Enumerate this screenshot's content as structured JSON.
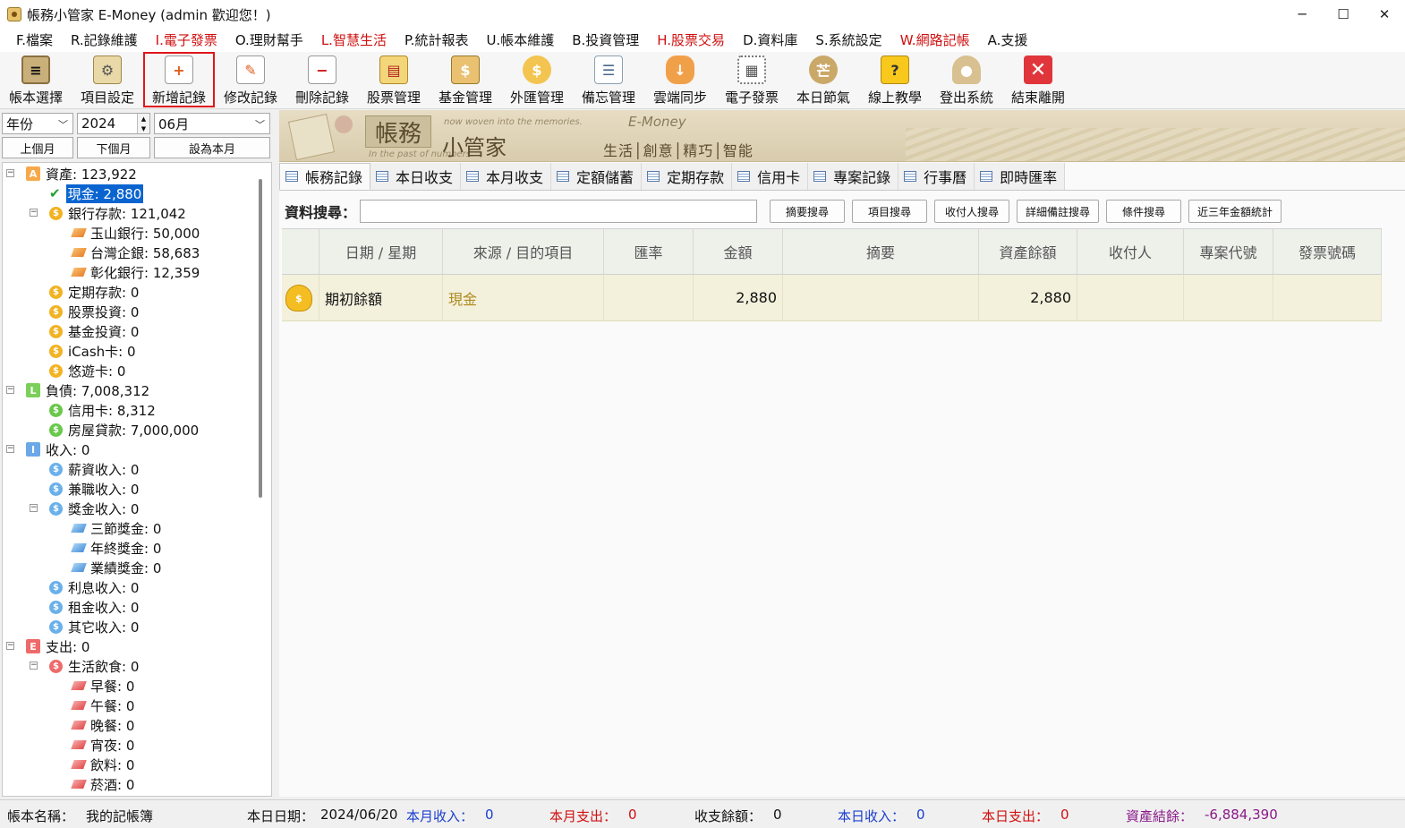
{
  "window": {
    "title": "帳務小管家 E-Money (admin 歡迎您！)",
    "minimize": "─",
    "maximize": "☐",
    "close": "✕"
  },
  "menu": [
    {
      "label": "F.檔案",
      "red": false
    },
    {
      "label": "R.記錄維護",
      "red": false
    },
    {
      "label": "I.電子發票",
      "red": true
    },
    {
      "label": "O.理財幫手",
      "red": false
    },
    {
      "label": "L.智慧生活",
      "red": true
    },
    {
      "label": "P.統計報表",
      "red": false
    },
    {
      "label": "U.帳本維護",
      "red": false
    },
    {
      "label": "B.投資管理",
      "red": false
    },
    {
      "label": "H.股票交易",
      "red": true
    },
    {
      "label": "D.資料庫",
      "red": false
    },
    {
      "label": "S.系統設定",
      "red": false
    },
    {
      "label": "W.網路記帳",
      "red": true
    },
    {
      "label": "A.支援",
      "red": false
    }
  ],
  "toolbar": [
    {
      "label": "帳本選擇",
      "icon": "ledger-book-icon",
      "glyph": "≡",
      "cls": "ic-book",
      "active": false
    },
    {
      "label": "項目設定",
      "icon": "item-gear-icon",
      "glyph": "⚙",
      "cls": "ic-gear",
      "active": false
    },
    {
      "label": "新增記錄",
      "icon": "add-record-icon",
      "glyph": "+",
      "cls": "ic-doc",
      "active": true
    },
    {
      "label": "修改記錄",
      "icon": "edit-record-icon",
      "glyph": "✎",
      "cls": "ic-doc",
      "active": false
    },
    {
      "label": "刪除記錄",
      "icon": "delete-record-icon",
      "glyph": "−",
      "cls": "ic-doc-red",
      "active": false
    },
    {
      "label": "股票管理",
      "icon": "stock-icon",
      "glyph": "▤",
      "cls": "ic-stock",
      "active": false
    },
    {
      "label": "基金管理",
      "icon": "fund-icon",
      "glyph": "$",
      "cls": "ic-fund",
      "active": false
    },
    {
      "label": "外匯管理",
      "icon": "forex-icon",
      "glyph": "$",
      "cls": "ic-fx",
      "active": false
    },
    {
      "label": "備忘管理",
      "icon": "memo-clipboard-icon",
      "glyph": "☰",
      "cls": "ic-memo",
      "active": false
    },
    {
      "label": "雲端同步",
      "icon": "cloud-sync-icon",
      "glyph": "↓",
      "cls": "ic-cloud",
      "active": false
    },
    {
      "label": "電子發票",
      "icon": "qr-code-icon",
      "glyph": "▦",
      "cls": "ic-qr",
      "active": false
    },
    {
      "label": "本日節氣",
      "icon": "solar-term-icon",
      "glyph": "芒",
      "cls": "ic-luck",
      "active": false
    },
    {
      "label": "線上教學",
      "icon": "help-question-icon",
      "glyph": "?",
      "cls": "ic-help",
      "active": false
    },
    {
      "label": "登出系統",
      "icon": "logout-user-icon",
      "glyph": "●",
      "cls": "ic-user",
      "active": false
    },
    {
      "label": "結束離開",
      "icon": "exit-close-icon",
      "glyph": "✕",
      "cls": "ic-exit",
      "active": false
    }
  ],
  "filters": {
    "period_type": "年份",
    "year": "2024",
    "month": "06月",
    "prev_month": "上個月",
    "next_month": "下個月",
    "set_current": "設為本月"
  },
  "tree": [
    {
      "level": 0,
      "kind": "badge",
      "mark": "A",
      "cls": "b-A",
      "label": "資產: 123,922",
      "exp": true
    },
    {
      "level": 1,
      "kind": "check",
      "label": "現金: 2,880",
      "selected": true
    },
    {
      "level": 1,
      "kind": "coin",
      "cls": "c-gold",
      "label": "銀行存款: 121,042",
      "exp": true
    },
    {
      "level": 2,
      "kind": "leaf",
      "cls": "l-orange",
      "label": "玉山銀行: 50,000"
    },
    {
      "level": 2,
      "kind": "leaf",
      "cls": "l-orange",
      "label": "台灣企銀: 58,683"
    },
    {
      "level": 2,
      "kind": "leaf",
      "cls": "l-orange",
      "label": "彰化銀行: 12,359"
    },
    {
      "level": 1,
      "kind": "coin",
      "cls": "c-gold",
      "label": "定期存款: 0"
    },
    {
      "level": 1,
      "kind": "coin",
      "cls": "c-gold",
      "label": "股票投資: 0"
    },
    {
      "level": 1,
      "kind": "coin",
      "cls": "c-gold",
      "label": "基金投資: 0"
    },
    {
      "level": 1,
      "kind": "coin",
      "cls": "c-gold",
      "label": "iCash卡: 0"
    },
    {
      "level": 1,
      "kind": "coin",
      "cls": "c-gold",
      "label": "悠遊卡: 0"
    },
    {
      "level": 0,
      "kind": "badge",
      "mark": "L",
      "cls": "b-L",
      "label": "負債: 7,008,312",
      "exp": true
    },
    {
      "level": 1,
      "kind": "coin",
      "cls": "c-green",
      "label": "信用卡: 8,312"
    },
    {
      "level": 1,
      "kind": "coin",
      "cls": "c-green",
      "label": "房屋貸款: 7,000,000"
    },
    {
      "level": 0,
      "kind": "badge",
      "mark": "I",
      "cls": "b-I",
      "label": "收入: 0",
      "exp": true
    },
    {
      "level": 1,
      "kind": "coin",
      "cls": "c-blue",
      "label": "薪資收入: 0"
    },
    {
      "level": 1,
      "kind": "coin",
      "cls": "c-blue",
      "label": "兼職收入: 0"
    },
    {
      "level": 1,
      "kind": "coin",
      "cls": "c-blue",
      "label": "獎金收入: 0",
      "exp": true
    },
    {
      "level": 2,
      "kind": "leaf",
      "cls": "l-blue",
      "label": "三節獎金: 0"
    },
    {
      "level": 2,
      "kind": "leaf",
      "cls": "l-blue",
      "label": "年終獎金: 0"
    },
    {
      "level": 2,
      "kind": "leaf",
      "cls": "l-blue",
      "label": "業績獎金: 0"
    },
    {
      "level": 1,
      "kind": "coin",
      "cls": "c-blue",
      "label": "利息收入: 0"
    },
    {
      "level": 1,
      "kind": "coin",
      "cls": "c-blue",
      "label": "租金收入: 0"
    },
    {
      "level": 1,
      "kind": "coin",
      "cls": "c-blue",
      "label": "其它收入: 0"
    },
    {
      "level": 0,
      "kind": "badge",
      "mark": "E",
      "cls": "b-E",
      "label": "支出: 0",
      "exp": true
    },
    {
      "level": 1,
      "kind": "coin",
      "cls": "c-red",
      "label": "生活飲食: 0",
      "exp": true
    },
    {
      "level": 2,
      "kind": "leaf",
      "cls": "l-red",
      "label": "早餐: 0"
    },
    {
      "level": 2,
      "kind": "leaf",
      "cls": "l-red",
      "label": "午餐: 0"
    },
    {
      "level": 2,
      "kind": "leaf",
      "cls": "l-red",
      "label": "晚餐: 0"
    },
    {
      "level": 2,
      "kind": "leaf",
      "cls": "l-red",
      "label": "宵夜: 0"
    },
    {
      "level": 2,
      "kind": "leaf",
      "cls": "l-red",
      "label": "飲料: 0"
    },
    {
      "level": 2,
      "kind": "leaf",
      "cls": "l-red",
      "label": "菸酒: 0"
    }
  ],
  "banner": {
    "tagline_top": "now woven into the memories.",
    "tagline_bottom": "In the past of numbers.",
    "title_a": "帳務",
    "title_b": "小管家",
    "brand": "E-Money",
    "slogan": "生活│創意│精巧│智能"
  },
  "tabs": [
    "帳務記錄",
    "本日收支",
    "本月收支",
    "定額儲蓄",
    "定期存款",
    "信用卡",
    "專案記錄",
    "行事曆",
    "即時匯率"
  ],
  "search": {
    "label": "資料搜尋：",
    "value": "",
    "buttons": [
      "摘要搜尋",
      "項目搜尋",
      "收付人搜尋",
      "詳細備註搜尋",
      "條件搜尋",
      "近三年金額統計"
    ]
  },
  "grid": {
    "columns": [
      "",
      "日期 / 星期",
      "來源 / 目的項目",
      "匯率",
      "金額",
      "摘要",
      "資產餘額",
      "收付人",
      "專案代號",
      "發票號碼"
    ],
    "rows": [
      {
        "date": "期初餘額",
        "item": "現金",
        "rate": "",
        "amount": "2,880",
        "memo": "",
        "balance": "2,880",
        "payee": "",
        "project": "",
        "invoice": ""
      }
    ]
  },
  "status": {
    "book_label": "帳本名稱：",
    "book_name": "我的記帳簿",
    "date_label": "本日日期：",
    "date": "2024/06/20",
    "month_income_label": "本月收入：",
    "month_income": "0",
    "month_expense_label": "本月支出：",
    "month_expense": "0",
    "balance_label": "收支餘額：",
    "balance": "0",
    "day_income_label": "本日收入：",
    "day_income": "0",
    "day_expense_label": "本日支出：",
    "day_expense": "0",
    "asset_label": "資產結餘：",
    "asset": "-6,884,390"
  }
}
